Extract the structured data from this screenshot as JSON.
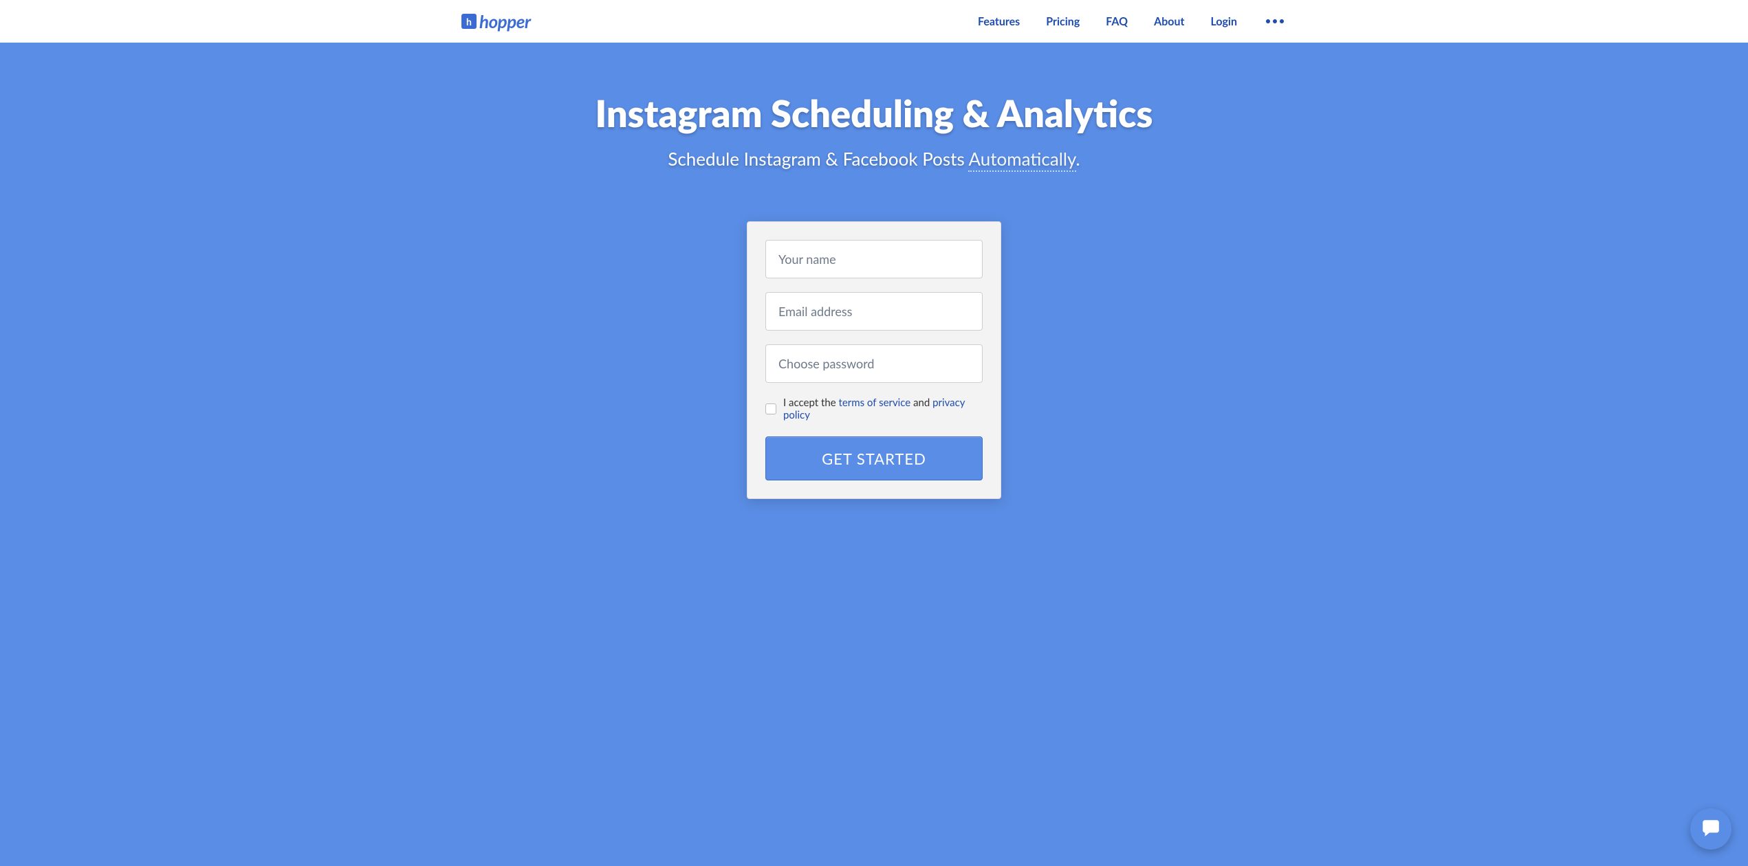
{
  "brand": {
    "name": "hopper",
    "icon_letter": "h"
  },
  "nav": {
    "items": [
      {
        "label": "Features"
      },
      {
        "label": "Pricing"
      },
      {
        "label": "FAQ"
      },
      {
        "label": "About"
      },
      {
        "label": "Login"
      }
    ]
  },
  "hero": {
    "title": "Instagram Scheduling & Analytics",
    "subtitle_prefix": "Schedule Instagram & Facebook Posts ",
    "subtitle_underlined": "Automatically",
    "subtitle_suffix": "."
  },
  "signup": {
    "name_placeholder": "Your name",
    "email_placeholder": "Email address",
    "password_placeholder": "Choose password",
    "accept_prefix": "I accept the ",
    "tos_label": "terms of service",
    "accept_and": " and ",
    "privacy_label": "privacy policy",
    "submit_label": "GET STARTED"
  },
  "colors": {
    "brand_blue": "#5a8de5",
    "nav_blue": "#1e4cb0"
  }
}
